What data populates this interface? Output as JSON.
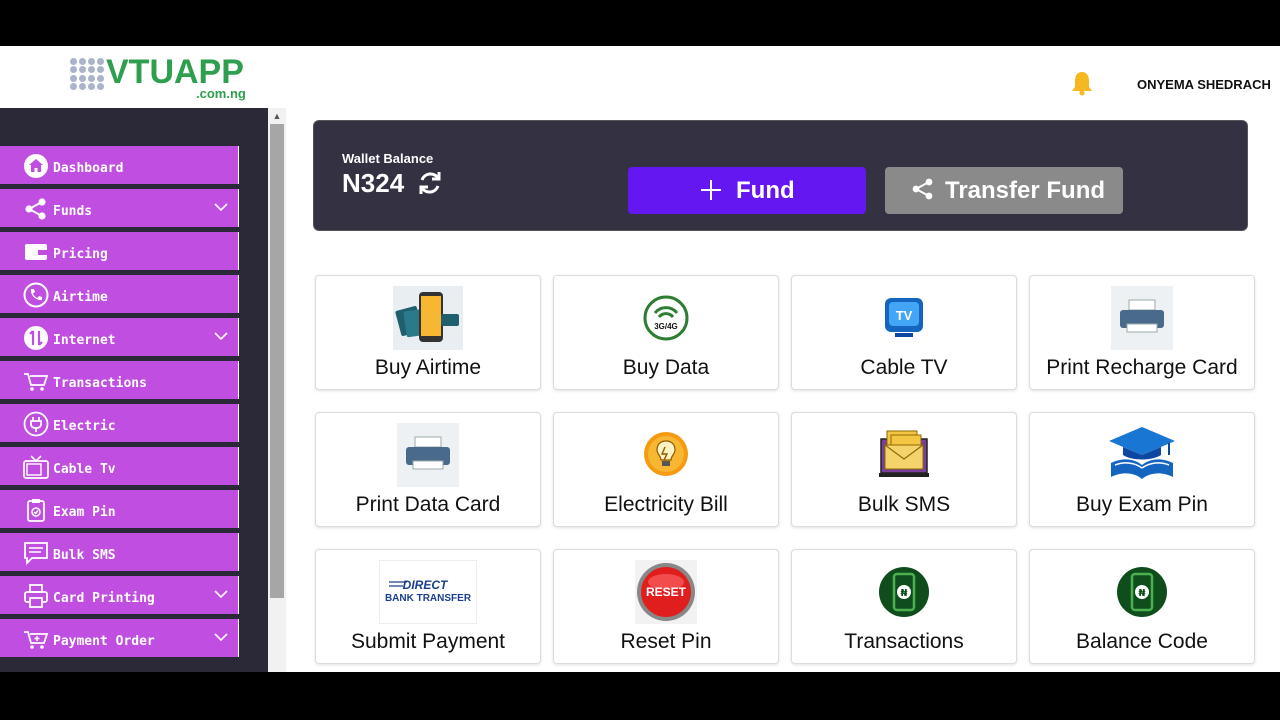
{
  "header": {
    "logo_text": "VTUAPP",
    "logo_sub": ".com.ng",
    "username": "ONYEMA SHEDRACH"
  },
  "sidebar": {
    "items": [
      {
        "label": "Dashboard",
        "icon": "home-icon",
        "expandable": false
      },
      {
        "label": "Funds",
        "icon": "share-icon",
        "expandable": true
      },
      {
        "label": "Pricing",
        "icon": "wallet-icon",
        "expandable": false
      },
      {
        "label": "Airtime",
        "icon": "phone-icon",
        "expandable": false
      },
      {
        "label": "Internet",
        "icon": "transfer-icon",
        "expandable": true
      },
      {
        "label": "Transactions",
        "icon": "cart-icon",
        "expandable": false
      },
      {
        "label": "Electric",
        "icon": "plug-icon",
        "expandable": false
      },
      {
        "label": "Cable Tv",
        "icon": "tv-icon",
        "expandable": false
      },
      {
        "label": "Exam Pin",
        "icon": "clipboard-icon",
        "expandable": false
      },
      {
        "label": "Bulk SMS",
        "icon": "message-icon",
        "expandable": false
      },
      {
        "label": "Card Printing",
        "icon": "printer-icon",
        "expandable": true
      },
      {
        "label": "Payment Order",
        "icon": "cart-plus-icon",
        "expandable": true
      }
    ]
  },
  "wallet": {
    "label": "Wallet Balance",
    "balance": "N324",
    "fund_label": "Fund",
    "transfer_label": "Transfer Fund"
  },
  "tiles": [
    {
      "label": "Buy Airtime",
      "icon": "airtime-phone-icon"
    },
    {
      "label": "Buy Data",
      "icon": "data-3g4g-icon"
    },
    {
      "label": "Cable TV",
      "icon": "tv-icon"
    },
    {
      "label": "Print Recharge Card",
      "icon": "printer-icon"
    },
    {
      "label": "Print Data Card",
      "icon": "printer-icon"
    },
    {
      "label": "Electricity Bill",
      "icon": "bulb-icon"
    },
    {
      "label": "Bulk SMS",
      "icon": "envelopes-icon"
    },
    {
      "label": "Buy Exam Pin",
      "icon": "graduation-cap-icon"
    },
    {
      "label": "Submit Payment",
      "icon": "direct-bank-transfer-icon",
      "icon_text_1": "DIRECT",
      "icon_text_2": "BANK TRANSFER"
    },
    {
      "label": "Reset Pin",
      "icon": "reset-button-icon",
      "icon_text": "RESET"
    },
    {
      "label": "Transactions",
      "icon": "naira-phone-icon"
    },
    {
      "label": "Balance Code",
      "icon": "naira-phone-icon"
    }
  ],
  "colors": {
    "accent_purple": "#c04ee0",
    "fund_button": "#6417f0",
    "transfer_button": "#8a8a8a",
    "sidebar_bg": "#2b2838",
    "wallet_bg": "#343142",
    "logo_green": "#2e9e4f"
  }
}
